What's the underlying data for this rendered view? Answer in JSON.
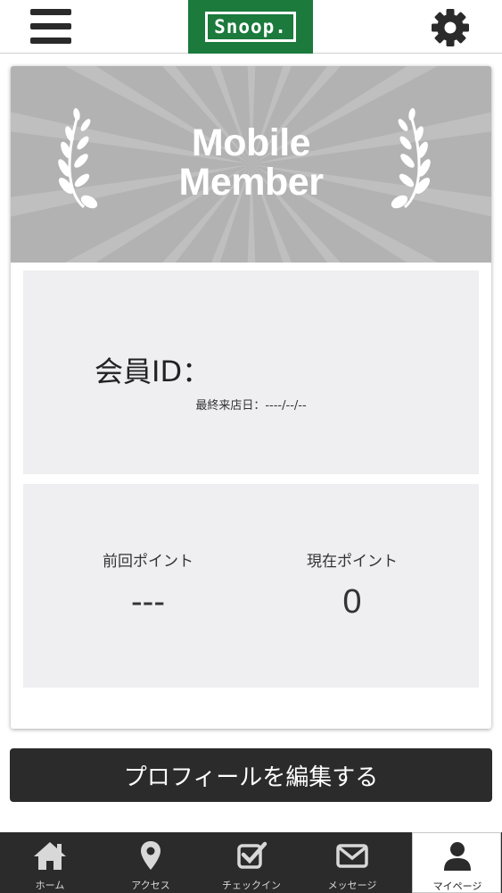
{
  "header": {
    "logo_text": "Snoop.",
    "menu_icon": "hamburger-menu-icon",
    "settings_icon": "gear-icon",
    "brand_color": "#1b7a3c"
  },
  "banner": {
    "title_line1": "Mobile",
    "title_line2": "Member",
    "background_color": "#b2b2b2"
  },
  "member": {
    "id_label": "会員ID：",
    "id_value": "",
    "last_visit_label": "最終来店日：",
    "last_visit_value": "----/--/--"
  },
  "points": {
    "previous_label": "前回ポイント",
    "previous_value": "---",
    "current_label": "現在ポイント",
    "current_value": "0"
  },
  "edit_profile_label": "プロフィールを編集する",
  "tabs": [
    {
      "label": "ホーム",
      "icon": "home-icon",
      "active": false
    },
    {
      "label": "アクセス",
      "icon": "map-pin-icon",
      "active": false
    },
    {
      "label": "チェックイン",
      "icon": "checkin-icon",
      "active": false
    },
    {
      "label": "メッセージ",
      "icon": "envelope-icon",
      "active": false
    },
    {
      "label": "マイページ",
      "icon": "user-icon",
      "active": true
    }
  ]
}
